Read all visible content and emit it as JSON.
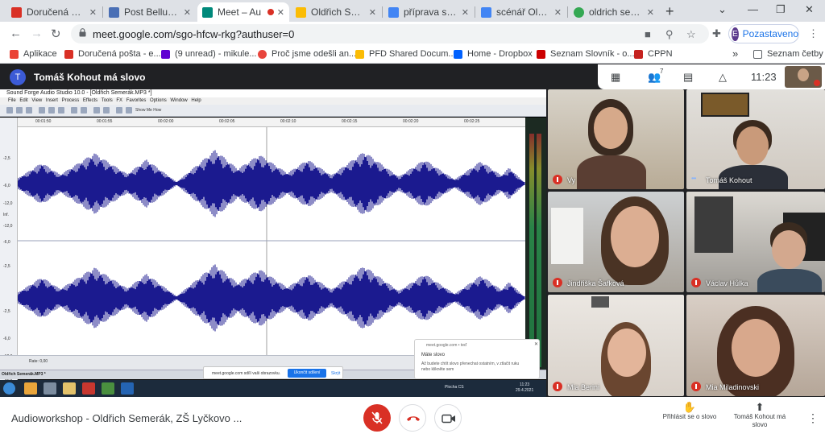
{
  "browser": {
    "tabs": [
      {
        "label": "Doručená pošt",
        "color": "#d93025"
      },
      {
        "label": "Post Bellum o...",
        "color": "#4a6fb5"
      },
      {
        "label": "Meet – Au",
        "color": "#00897b"
      },
      {
        "label": "Oldřich Semerák",
        "color": "#fbbc04"
      },
      {
        "label": "příprava scénář",
        "color": "#4285f4"
      },
      {
        "label": "scénář Oldřich",
        "color": "#4285f4"
      },
      {
        "label": "oldrich semerak",
        "color": "#34a853"
      }
    ],
    "new_tab": "+",
    "window_controls": {
      "chevron": "⌄",
      "minimize": "—",
      "restore": "❐",
      "close": "✕"
    },
    "url": "meet.google.com/sgo-hfcw-rkg?authuser=0",
    "profile_initial": "E",
    "profile_status": "Pozastaveno",
    "bookmarks": [
      {
        "label": "Aplikace",
        "color": "#ea4335"
      },
      {
        "label": "Doručená pošta - e...",
        "color": "#d93025"
      },
      {
        "label": "(9 unread) - mikule...",
        "color": "#6001d2"
      },
      {
        "label": "Proč jsme odešli an...",
        "color": "#e8453c"
      },
      {
        "label": "PFD Shared Docum...",
        "color": "#fbbc04"
      },
      {
        "label": "Home - Dropbox",
        "color": "#0061fe"
      },
      {
        "label": "Seznam Slovník - o...",
        "color": "#cc0000"
      },
      {
        "label": "CPPN",
        "color": "#c5221f"
      }
    ],
    "bookmarks_more": "»",
    "reading_list": "Seznam četby"
  },
  "meet": {
    "speaker_initial": "T",
    "speaker_text": "Tomáš Kohout má slovo",
    "participant_badge": "7",
    "time": "11:23",
    "meeting_title": "Audioworkshop - Oldřich Semerák, ZŠ Lyčkovo ...",
    "raise_hand_label": "Přihlásit se o slovo",
    "presenting_label": "Tomáš Kohout má slovo",
    "participants": [
      {
        "name": "Vy",
        "mic": "off"
      },
      {
        "name": "Tomáš Kohout",
        "mic": "on"
      },
      {
        "name": "Jindřiška Šafková",
        "mic": "off"
      },
      {
        "name": "Václav Hůlka",
        "mic": "off"
      },
      {
        "name": "Mia Berini",
        "mic": "off"
      },
      {
        "name": "Mia Miladinovski",
        "mic": "off"
      }
    ]
  },
  "screen_share": {
    "window_title": "Sound Forge Audio Studio 10.0 - [Oldřich Semerák.MP3 *]",
    "menu": "File Edit View Insert Process Effects Tools FX Favorites Options Window Help",
    "toolbar_text": "Show Me How",
    "ruler_ticks": [
      "00:01:50",
      "00:01:55",
      "00:02:00",
      "00:02:05",
      "00:02:10",
      "00:02:15",
      "00:02:20",
      "00:02:25"
    ],
    "db_labels": [
      "-2,5",
      "-6,0",
      "-12,0",
      "Inf.",
      "-12,0",
      "-6,0",
      "-2,5"
    ],
    "status_text": "Rate: 0,00",
    "file_tab": "Oldřich Semerák.MP3 *",
    "share_text": "meet.google.com sdílí vaši obrazovku.",
    "share_stop": "Ukončit sdílení",
    "share_hide": "Skrýt",
    "notif_head": "meet.google.com • teď",
    "notif_title": "Máte slovo",
    "notif_body": "Až budete chtít slovo přenechat ostatním, v ztlačit ruku nebo klikněte sem",
    "tray_text": "Plocha   CS",
    "clock_time": "11:23",
    "clock_date": "29.4.2021"
  }
}
